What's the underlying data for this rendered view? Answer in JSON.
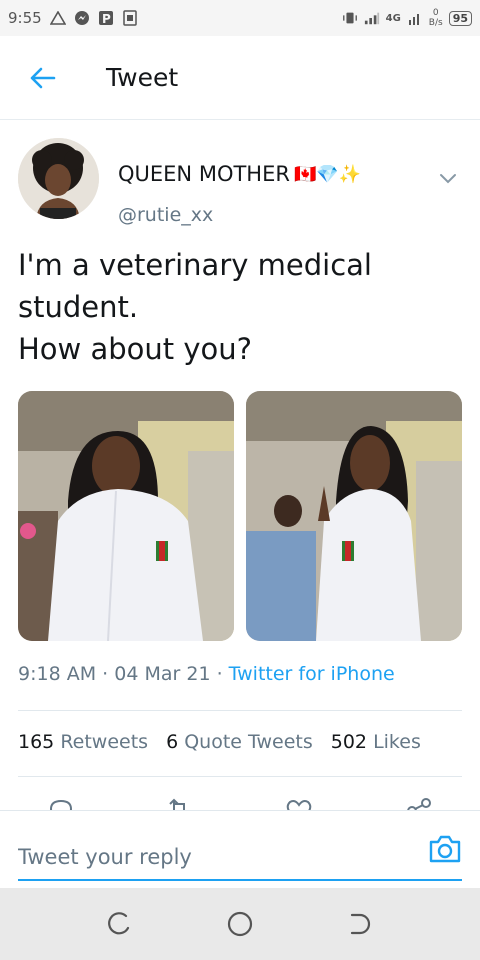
{
  "status_bar": {
    "time": "9:55",
    "network": "4G",
    "speed_value": "0",
    "speed_unit": "B/s",
    "battery": "95"
  },
  "header": {
    "title": "Tweet"
  },
  "tweet": {
    "author_name": "QUEEN MOTHER",
    "author_emojis": "🇨🇦💎✨",
    "author_handle": "@rutie_xx",
    "text_lines": [
      "I'm a veterinary medical",
      "student.",
      "How about you?"
    ],
    "time": "9:18 AM",
    "date": "04 Mar 21",
    "source": "Twitter for iPhone",
    "retweets_count": "165",
    "retweets_label": "Retweets",
    "quotes_count": "6",
    "quotes_label": "Quote Tweets",
    "likes_count": "502",
    "likes_label": "Likes"
  },
  "reply": {
    "placeholder": "Tweet your reply"
  },
  "colors": {
    "accent": "#1da1f2",
    "secondary_text": "#657786"
  }
}
